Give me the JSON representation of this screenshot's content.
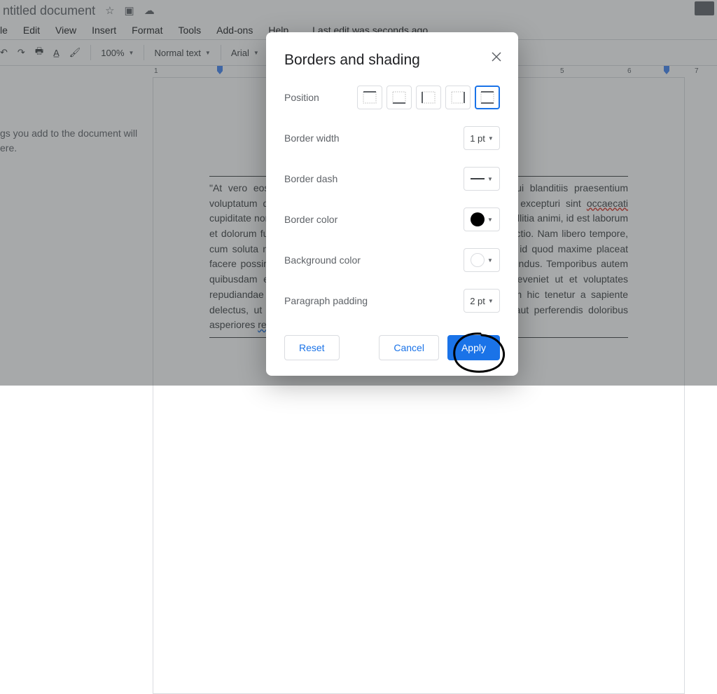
{
  "titlebar": {
    "doc_title": "ntitled document"
  },
  "menubar": {
    "items": [
      "le",
      "Edit",
      "View",
      "Insert",
      "Format",
      "Tools",
      "Add-ons",
      "Help"
    ],
    "last_edit": "Last edit was seconds ago"
  },
  "toolbar": {
    "zoom": "100%",
    "style": "Normal text",
    "font": "Arial"
  },
  "ruler": {
    "nums": [
      "1",
      "5",
      "6",
      "7"
    ]
  },
  "outline": {
    "line1": "gs you add to the document will",
    "line2": "ere."
  },
  "page": {
    "body": "\"At vero eos et accusamus et iusto odio dignissimos ducimus qui blanditiis praesentium voluptatum deleniti atque corrupti quos dolores et quas molestias excepturi sint ",
    "miss1": "occaecati",
    "body2": " cupiditate non provident, similique sunt in culpa qui officia deserunt mollitia animi, id est laborum et dolorum fuga. Et harum quidem rerum facilis est et expedita distinctio. Nam libero tempore, cum soluta nobis est eligendi optio cumque nihil impedit quo minus id quod maxime placeat facere possimus, omnis voluptas assumenda est, omnis dolor repellendus. Temporibus autem quibusdam et aut officiis debitis aut rerum necessitatibus saepe eveniet ut et voluptates repudiandae sint et molestiae non recusandae. Itaque earum rerum hic tenetur a sapiente delectus, ut aut reiciendis voluptatibus maiores alias consequatur aut perferendis doloribus asperiores ",
    "miss2": "repellat",
    "body3": ".\""
  },
  "dialog": {
    "title": "Borders and shading",
    "labels": {
      "position": "Position",
      "width": "Border width",
      "dash": "Border dash",
      "color": "Border color",
      "bg": "Background color",
      "padding": "Paragraph padding"
    },
    "values": {
      "width": "1 pt",
      "padding": "2 pt"
    },
    "buttons": {
      "reset": "Reset",
      "cancel": "Cancel",
      "apply": "Apply"
    }
  }
}
